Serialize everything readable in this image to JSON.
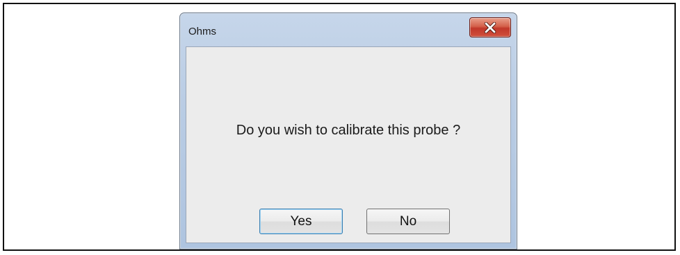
{
  "dialog": {
    "title": "Ohms",
    "message": "Do you wish to calibrate this probe ?",
    "buttons": {
      "yes_label": "Yes",
      "no_label": "No"
    },
    "close_icon": "close-x-icon"
  },
  "colors": {
    "title_bar": "#b9cce4",
    "client_bg": "#ececec",
    "close_button": "#c1382a",
    "default_button_border": "#3c7fb1"
  }
}
